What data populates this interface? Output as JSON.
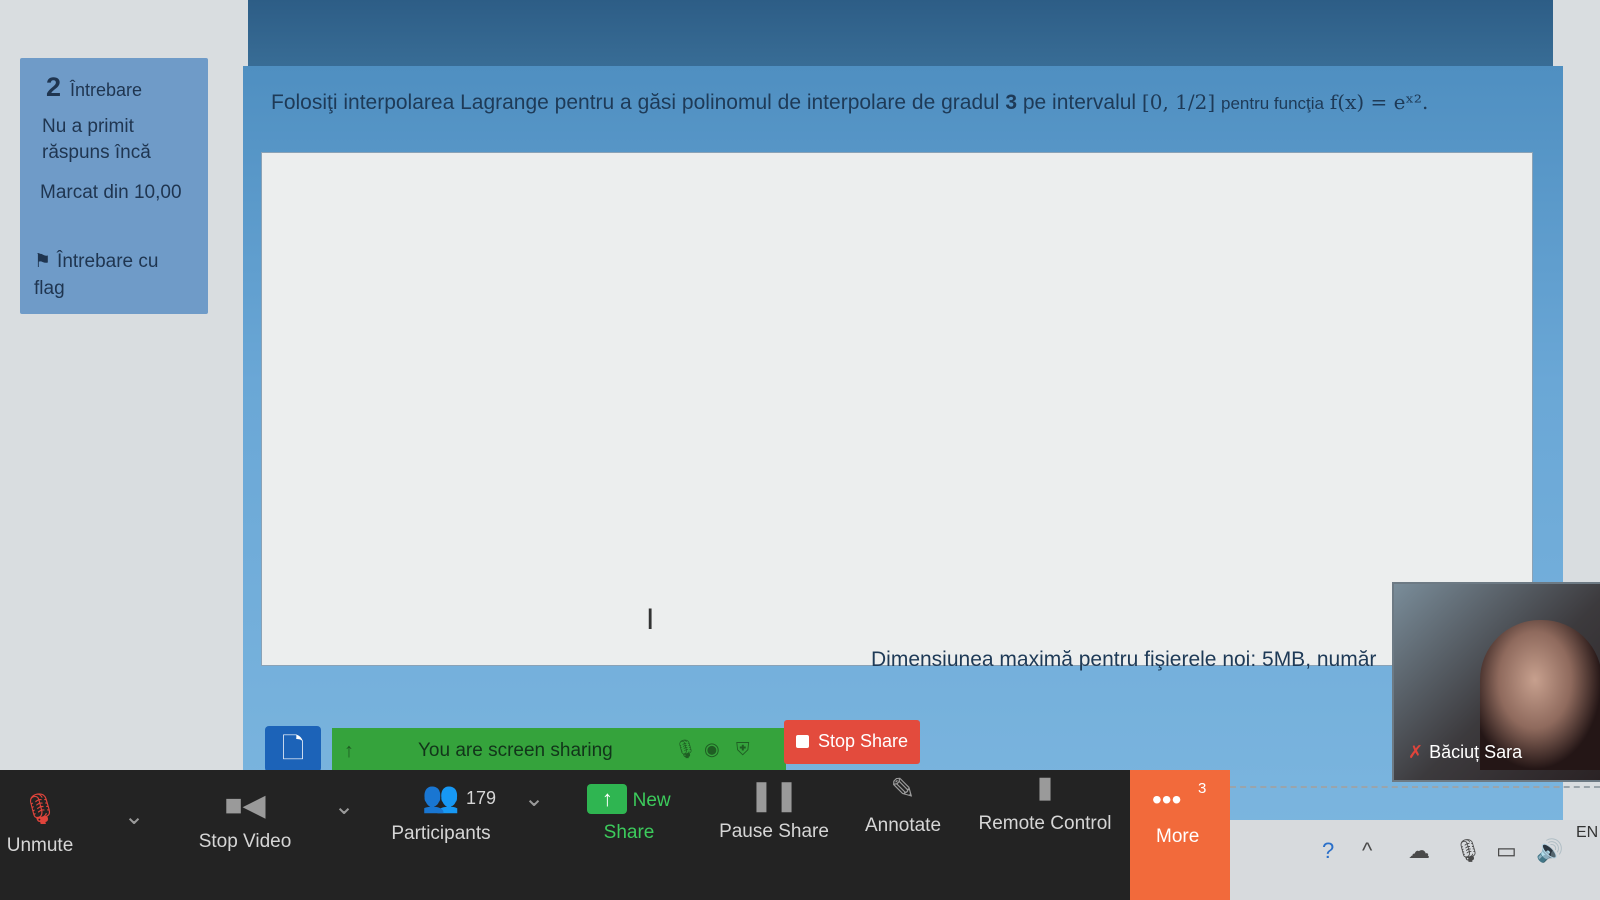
{
  "question_info": {
    "number": "2",
    "word": "Întrebare",
    "status": "Nu a primit răspuns încă",
    "mark": "Marcat din 10,00",
    "flag_label": "Întrebare cu flag"
  },
  "question": {
    "text_main": "Folosiţi interpolarea Lagrange pentru a găsi polinomul de interpolare de gradul",
    "degree": "3",
    "text_on": "pe intervalul",
    "interval": "[0, 1/2]",
    "text_function": "pentru funcţia",
    "function": "f(x) = eˣ²."
  },
  "upload": {
    "info": "Dimensiunea maximă pentru fişierele noi: 5MB, număr"
  },
  "share_banner": {
    "label": "You are screen sharing",
    "stop_label": "Stop Share"
  },
  "toolbar": {
    "unmute": "Unmute",
    "stop_video": "Stop Video",
    "participants": "Participants",
    "participants_count": "179",
    "new_share": "New Share",
    "pause_share": "Pause Share",
    "annotate": "Annotate",
    "remote_control": "Remote Control",
    "more": "More",
    "more_badge": "3"
  },
  "video": {
    "name": "Băciuț Sara"
  },
  "tray": {
    "lang": "EN"
  },
  "colors": {
    "card_blue": "#6aa7d6",
    "toolbar": "#232323",
    "share_green": "#35a33c",
    "stop_red": "#e34b3d",
    "more_orange": "#f26a3b"
  },
  "icons": [
    "arrow-up-icon",
    "mic-muted-icon",
    "record-icon",
    "shield-icon",
    "stop-icon",
    "chevron-down-icon",
    "camera-icon",
    "participants-icon",
    "share-arrow-icon",
    "pause-icon",
    "pencil-icon",
    "mouse-icon",
    "dots-icon",
    "file-icon",
    "flag-icon",
    "help-icon",
    "caret-up-icon",
    "cloud-icon",
    "microphone-icon",
    "battery-icon",
    "speaker-icon",
    "text-cursor-icon"
  ]
}
